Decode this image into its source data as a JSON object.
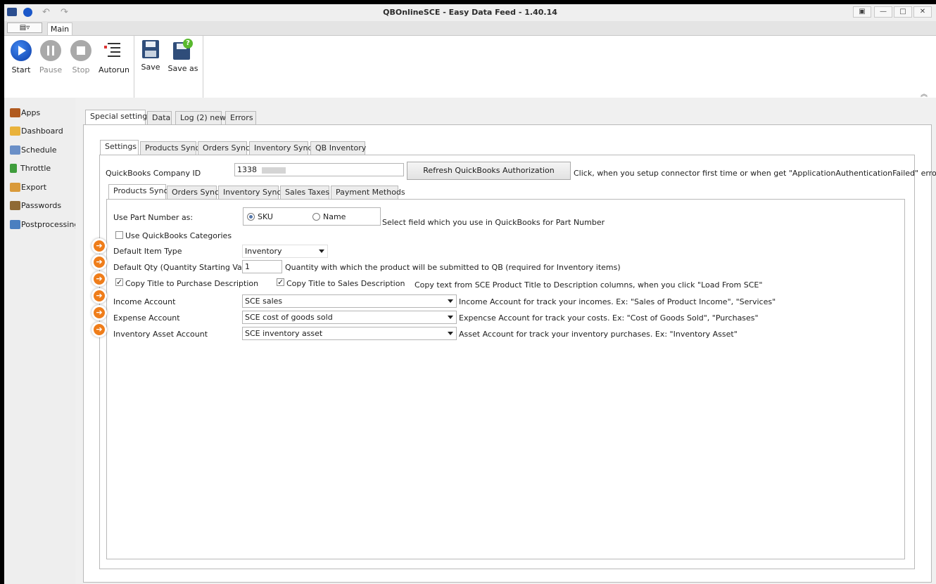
{
  "window": {
    "app_icon": "qb-app-icon",
    "title": "QBOnlineSCE - Easy Data Feed - 1.40.14",
    "controls": [
      "restore-icon",
      "minimize-icon",
      "maximize-icon",
      "close-icon"
    ]
  },
  "ribbon": {
    "tab_main": "Main",
    "buttons": {
      "start": "Start",
      "pause": "Pause",
      "stop": "Stop",
      "autorun": "Autorun",
      "save": "Save",
      "save_as": "Save as"
    }
  },
  "sidebar": {
    "items": [
      {
        "label": "Apps",
        "icon": "briefcase-icon"
      },
      {
        "label": "Dashboard",
        "icon": "home-icon"
      },
      {
        "label": "Schedule",
        "icon": "schedule-icon"
      },
      {
        "label": "Throttle",
        "icon": "flag-icon"
      },
      {
        "label": "Export",
        "icon": "table-icon"
      },
      {
        "label": "Passwords",
        "icon": "users-icon"
      },
      {
        "label": "Postprocessing",
        "icon": "postprocessing-icon"
      }
    ]
  },
  "top_tabs": [
    "Special settings",
    "Data",
    "Log (2) new",
    "Errors"
  ],
  "settings_tabs": [
    "Settings",
    "Products Sync",
    "Orders Sync",
    "Inventory Sync",
    "QB Inventory"
  ],
  "company": {
    "label": "QuickBooks Company ID",
    "value": "1338",
    "refresh_button": "Refresh QuickBooks Authorization",
    "hint": "Click, when you setup connector first time or when get \"ApplicationAuthenticationFailed\" error"
  },
  "inner_tabs": [
    "Products Sync",
    "Orders Sync",
    "Inventory Sync",
    "Sales Taxes",
    "Payment Methods"
  ],
  "products_sync": {
    "part_number_label": "Use Part Number as:",
    "radio_sku": "SKU",
    "radio_name": "Name",
    "part_number_hint": "Select field which you use in QuickBooks for Part Number",
    "use_categories": "Use QuickBooks Categories",
    "item_type_label": "Default Item Type",
    "item_type_value": "Inventory",
    "qty_label": "Default Qty (Quantity Starting Value)",
    "qty_value": "1",
    "qty_hint": "Quantity with which the product will be submitted to QB (required for Inventory items)",
    "copy_purchase": "Copy Title to Purchase Description",
    "copy_sales": "Copy Title to Sales Description",
    "copy_hint": "Copy text from SCE Product Title to Description columns, when you click \"Load From SCE\"",
    "income_label": "Income Account",
    "income_value": "SCE sales",
    "income_hint": "Income Account for track your incomes. Ex: \"Sales of Product Income\", \"Services\"",
    "expense_label": "Expense Account",
    "expense_value": "SCE cost of goods sold",
    "expense_hint": "Expencse Account for track your costs. Ex: \"Cost of Goods Sold\", \"Purchases\"",
    "asset_label": "Inventory Asset Account",
    "asset_value": "SCE inventory asset",
    "asset_hint": "Asset Account for track your inventory purchases. Ex: \"Inventory Asset\""
  },
  "colors": {
    "accent_orange": "#ef7d1a",
    "play_blue": "#1a57c9"
  }
}
